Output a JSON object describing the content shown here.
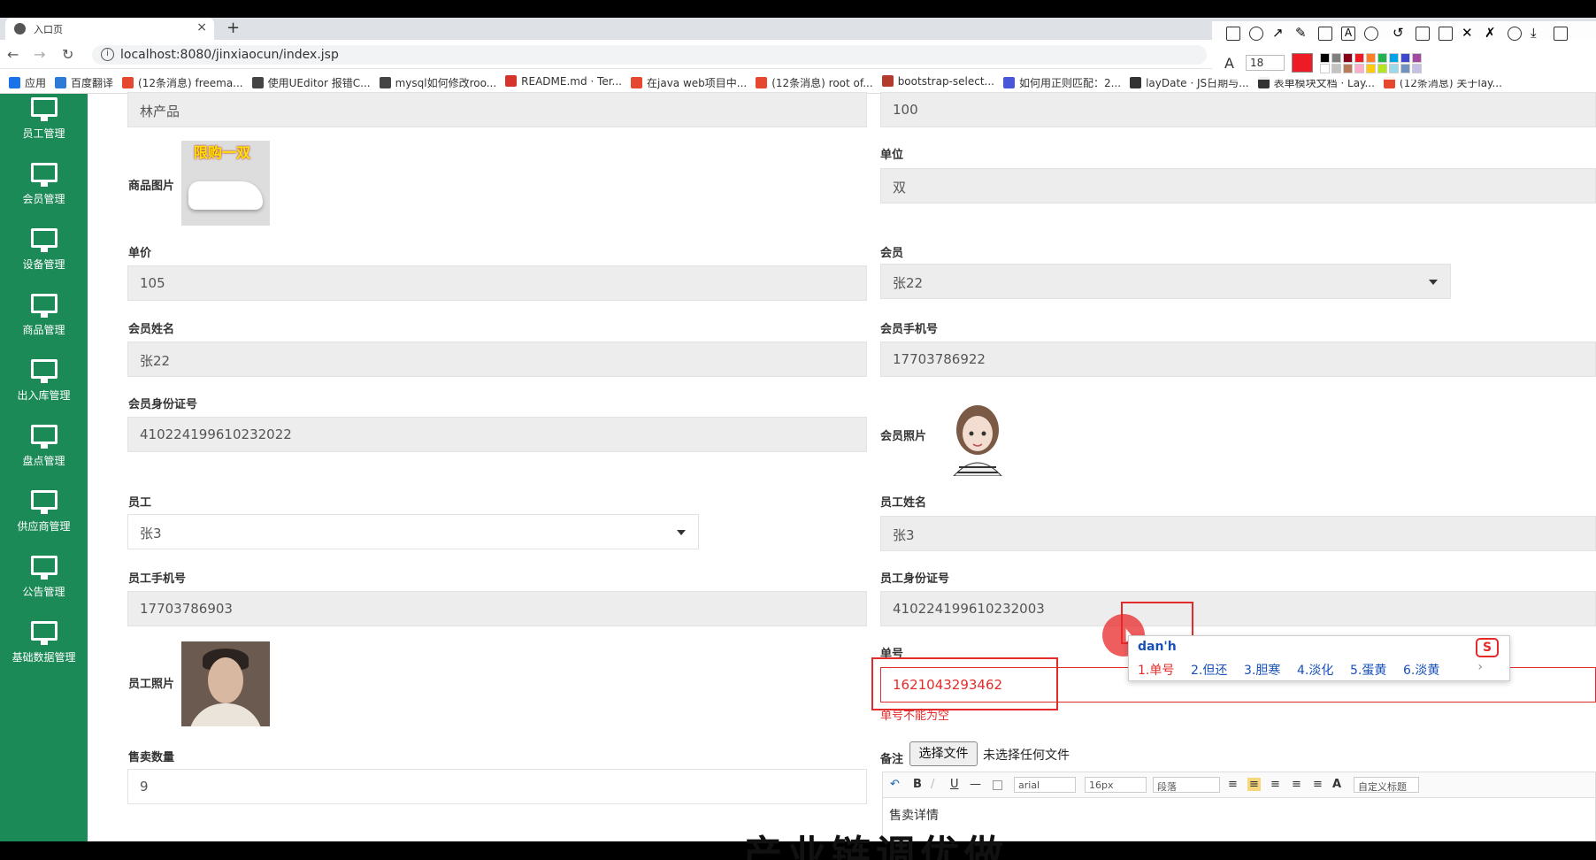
{
  "browser": {
    "tab_title": "入口页",
    "url": "localhost:8080/jinxiaocun/index.jsp",
    "new_tab": "+",
    "close": "×",
    "bookmarks": [
      {
        "label": "应用",
        "color": "#1a73e8"
      },
      {
        "label": "百度翻译",
        "color": "#2b7bd7"
      },
      {
        "label": "(12条消息) freema...",
        "color": "#e5472f"
      },
      {
        "label": "使用UEditor 报错C...",
        "color": "#444444"
      },
      {
        "label": "mysql如何修改roo...",
        "color": "#444444"
      },
      {
        "label": "README.md · Ter...",
        "color": "#d4342c"
      },
      {
        "label": "在java web项目中...",
        "color": "#e5472f"
      },
      {
        "label": "(12条消息) root of...",
        "color": "#e5472f"
      },
      {
        "label": "bootstrap-select...",
        "color": "#b33b2e"
      },
      {
        "label": "如何用正则匹配：2...",
        "color": "#4a56d9"
      },
      {
        "label": "layDate · JS日期与...",
        "color": "#333333"
      },
      {
        "label": "表单模块文档 · Lay...",
        "color": "#333333"
      },
      {
        "label": "(12条消息) 关于lay...",
        "color": "#e5472f"
      }
    ],
    "tool_font_size": "18",
    "tool_colors": [
      "#000000",
      "#7f7f7f",
      "#880015",
      "#ed1c24",
      "#ff7f27",
      "#22b14c",
      "#00a2e8",
      "#3f48cc",
      "#a349a4",
      "#ffffff",
      "#c3c3c3",
      "#b97a57",
      "#ffaec9",
      "#ffc90e",
      "#b5e61d",
      "#99d9ea",
      "#7092be",
      "#c8bfe7"
    ],
    "tool_active_color": "#ed1c24"
  },
  "sidebar": {
    "bg": "#1c8a57",
    "items": [
      {
        "label": "员工管理"
      },
      {
        "label": "会员管理"
      },
      {
        "label": "设备管理"
      },
      {
        "label": "商品管理"
      },
      {
        "label": "出入库管理"
      },
      {
        "label": "盘点管理"
      },
      {
        "label": "供应商管理"
      },
      {
        "label": "公告管理"
      },
      {
        "label": "基础数据管理"
      }
    ]
  },
  "form": {
    "top_left_value": "林产品",
    "top_right_value": "100",
    "product_image_label": "商品图片",
    "product_image_promo": "限购一双",
    "unit_label": "单位",
    "unit_value": "双",
    "price_label": "单价",
    "price_value": "105",
    "member_label": "会员",
    "member_value": "张22",
    "member_name_label": "会员姓名",
    "member_name_value": "张22",
    "member_phone_label": "会员手机号",
    "member_phone_value": "17703786922",
    "member_id_label": "会员身份证号",
    "member_id_value": "410224199610232022",
    "member_photo_label": "会员照片",
    "employee_label": "员工",
    "employee_value": "张3",
    "employee_name_label": "员工姓名",
    "employee_name_value": "张3",
    "employee_phone_label": "员工手机号",
    "employee_phone_value": "17703786903",
    "employee_id_label": "员工身份证号",
    "employee_id_value": "410224199610232003",
    "order_no_label": "单号",
    "order_no_value": "1621043293462",
    "order_no_error": "单号不能为空",
    "employee_photo_label": "员工照片",
    "sale_qty_label": "售卖数量",
    "sale_qty_value": "9",
    "remark_label": "备注",
    "file_button": "选择文件",
    "file_status": "未选择任何文件",
    "editor_font": "arial",
    "editor_size": "16px",
    "editor_para": "段落",
    "editor_custom_title": "自定义标题",
    "editor_text": "售卖详情"
  },
  "ime": {
    "pinyin": "dan'h",
    "candidates": [
      "1.单号",
      "2.但还",
      "3.胆寒",
      "4.淡化",
      "5.蛋黄",
      "6.淡黄"
    ],
    "more": "›",
    "logo": "S"
  },
  "caption": "产业链调优做"
}
